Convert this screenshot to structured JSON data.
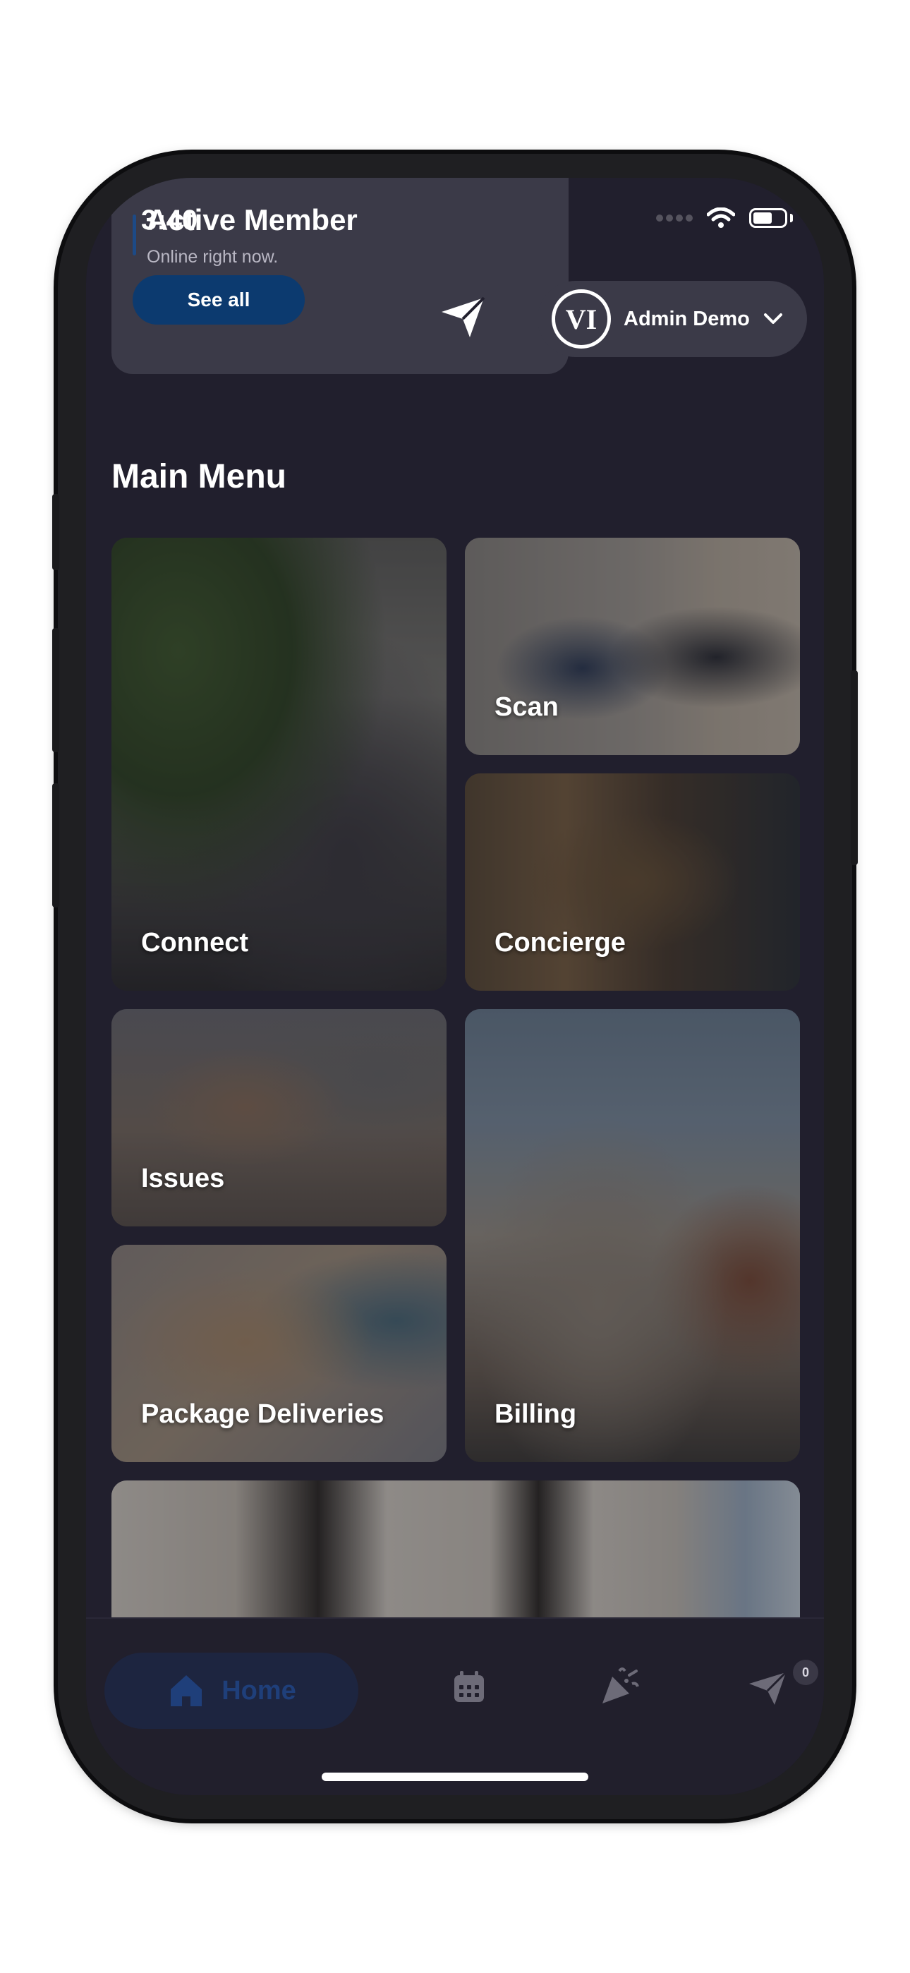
{
  "status_bar": {
    "time": "3:40"
  },
  "member_card": {
    "title": "Active Member",
    "subtitle": "Online right now.",
    "see_all_label": "See all"
  },
  "header": {
    "logo_text": "VI",
    "user_name": "Admin Demo"
  },
  "main_menu": {
    "title": "Main Menu",
    "tiles": [
      {
        "label": "Connect"
      },
      {
        "label": "Scan"
      },
      {
        "label": "Concierge"
      },
      {
        "label": "Issues"
      },
      {
        "label": "Billing"
      },
      {
        "label": "Package Deliveries"
      }
    ]
  },
  "tab_bar": {
    "home_label": "Home",
    "notification_count": "0",
    "icons": [
      "home-icon",
      "calendar-icon",
      "celebration-icon",
      "send-icon"
    ]
  },
  "colors": {
    "background": "#211f2d",
    "card": "#3b3a48",
    "accent": "#0c3a6f"
  }
}
